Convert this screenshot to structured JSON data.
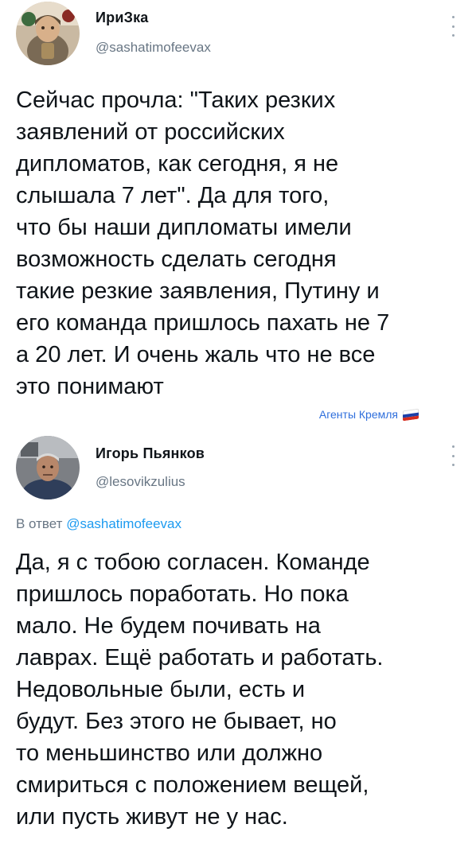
{
  "tweet1": {
    "author_name": "ИриЗка",
    "author_handle": "@sashatimofeevax",
    "text": "Сейчас прочла: \"Таких резких\nзаявлений от российских\nдипломатов, как сегодня, я не\nслышала 7 лет\". Да для того,\nчто бы наши дипломаты имели\nвозможность сделать сегодня\nтакие резкие заявления, Путину и\nего команда пришлось пахать не 7\nа 20 лет. И очень жаль что не все\nэто понимают",
    "watermark": "Агенты Кремля"
  },
  "tweet2": {
    "author_name": "Игорь Пьянков",
    "author_handle": "@lesovikzulius",
    "reply_prefix": "В ответ",
    "reply_handle": "@sashatimofeevax",
    "text": "Да, я с тобою согласен. Команде\nпришлось поработать. Но пока\nмало. Не будем почивать на\nлаврах. Ещё работать и работать.\nНедовольные были, есть и\nбудут. Без этого не бывает, но\nто меньшинство или должно\nсмириться с положением вещей,\nили пусть живут не у нас."
  },
  "colors": {
    "text": "#0f1419",
    "secondary": "#687684",
    "link": "#1d9bf0",
    "watermark": "#2f6fdc",
    "flag": [
      "#ffffff",
      "#1c3fa8",
      "#d52b1e"
    ]
  },
  "icons": {
    "more": "more-vertical-icon",
    "flag": "russian-flag-icon"
  }
}
